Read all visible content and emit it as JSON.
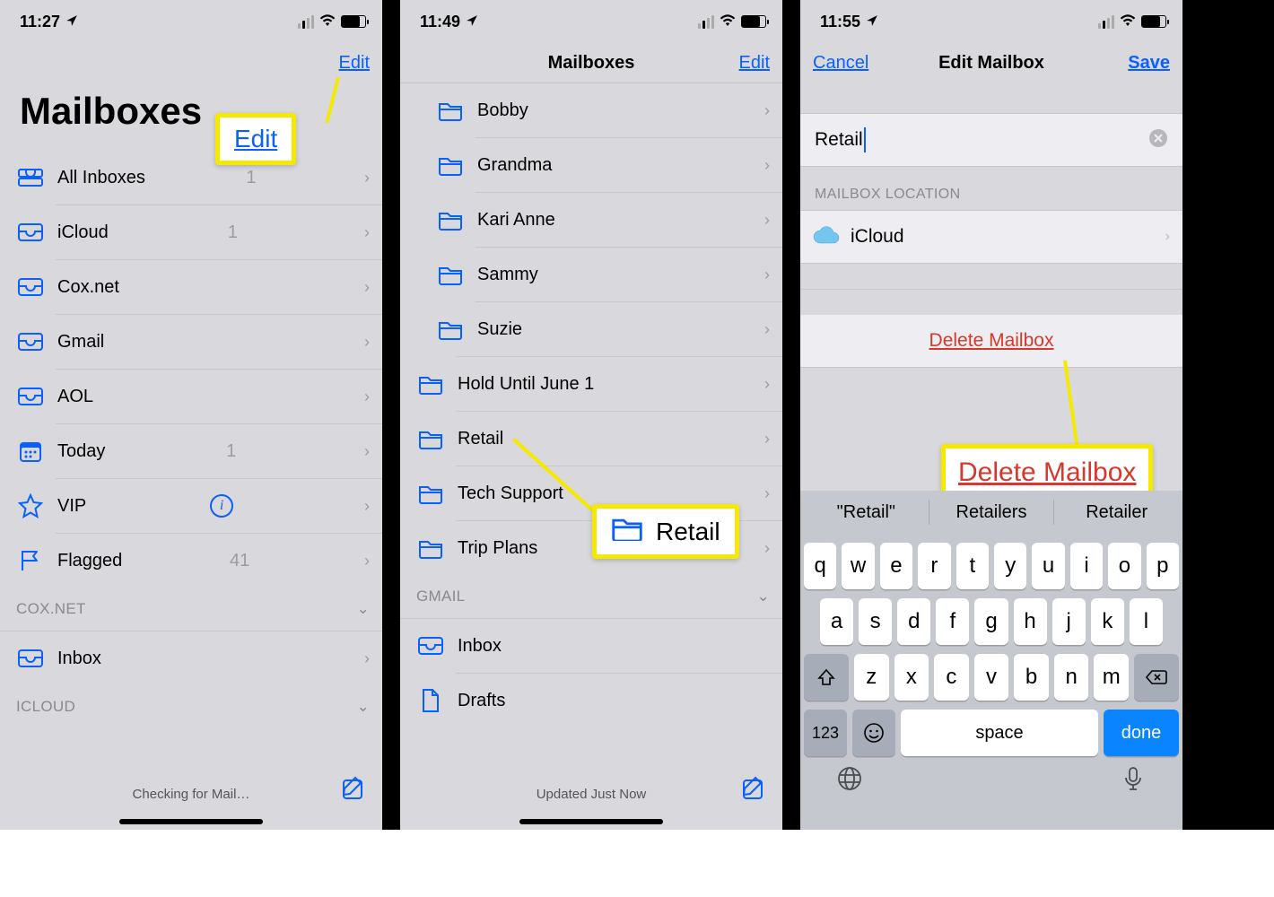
{
  "panel1": {
    "time": "11:27",
    "nav_edit": "Edit",
    "title": "Mailboxes",
    "callout_edit": "Edit",
    "rows": [
      {
        "label": "All Inboxes",
        "count": "1",
        "chev": true,
        "icon": "tray-stack"
      },
      {
        "label": "iCloud",
        "count": "1",
        "chev": true,
        "icon": "tray"
      },
      {
        "label": "Cox.net",
        "count": "",
        "chev": true,
        "icon": "tray"
      },
      {
        "label": "Gmail",
        "count": "",
        "chev": true,
        "icon": "tray"
      },
      {
        "label": "AOL",
        "count": "",
        "chev": true,
        "icon": "tray"
      },
      {
        "label": "Today",
        "count": "1",
        "chev": true,
        "icon": "calendar"
      },
      {
        "label": "VIP",
        "count": "",
        "chev": true,
        "icon": "star",
        "info": true
      },
      {
        "label": "Flagged",
        "count": "41",
        "chev": true,
        "icon": "flag"
      }
    ],
    "section1": "COX.NET",
    "cox_inbox": "Inbox",
    "section2": "ICLOUD",
    "status": "Checking for Mail…"
  },
  "panel2": {
    "time": "11:49",
    "title": "Mailboxes",
    "nav_edit": "Edit",
    "folders": [
      "Bobby",
      "Grandma",
      "Kari Anne",
      "Sammy",
      "Suzie",
      "Hold Until June 1",
      "Retail",
      "Tech Support",
      "Trip Plans"
    ],
    "section_gmail": "GMAIL",
    "gmail_inbox": "Inbox",
    "gmail_drafts": "Drafts",
    "callout_retail": "Retail",
    "status": "Updated Just Now"
  },
  "panel3": {
    "time": "11:55",
    "nav_cancel": "Cancel",
    "nav_title": "Edit Mailbox",
    "nav_save": "Save",
    "input_value": "Retail",
    "location_label": "MAILBOX LOCATION",
    "location_value": "iCloud",
    "delete_label": "Delete Mailbox",
    "callout_delete": "Delete Mailbox",
    "suggestions": [
      "\"Retail\"",
      "Retailers",
      "Retailer"
    ],
    "kb": {
      "r1": [
        "q",
        "w",
        "e",
        "r",
        "t",
        "y",
        "u",
        "i",
        "o",
        "p"
      ],
      "r2": [
        "a",
        "s",
        "d",
        "f",
        "g",
        "h",
        "j",
        "k",
        "l"
      ],
      "r3": [
        "z",
        "x",
        "c",
        "v",
        "b",
        "n",
        "m"
      ],
      "n123": "123",
      "space": "space",
      "done": "done"
    }
  }
}
